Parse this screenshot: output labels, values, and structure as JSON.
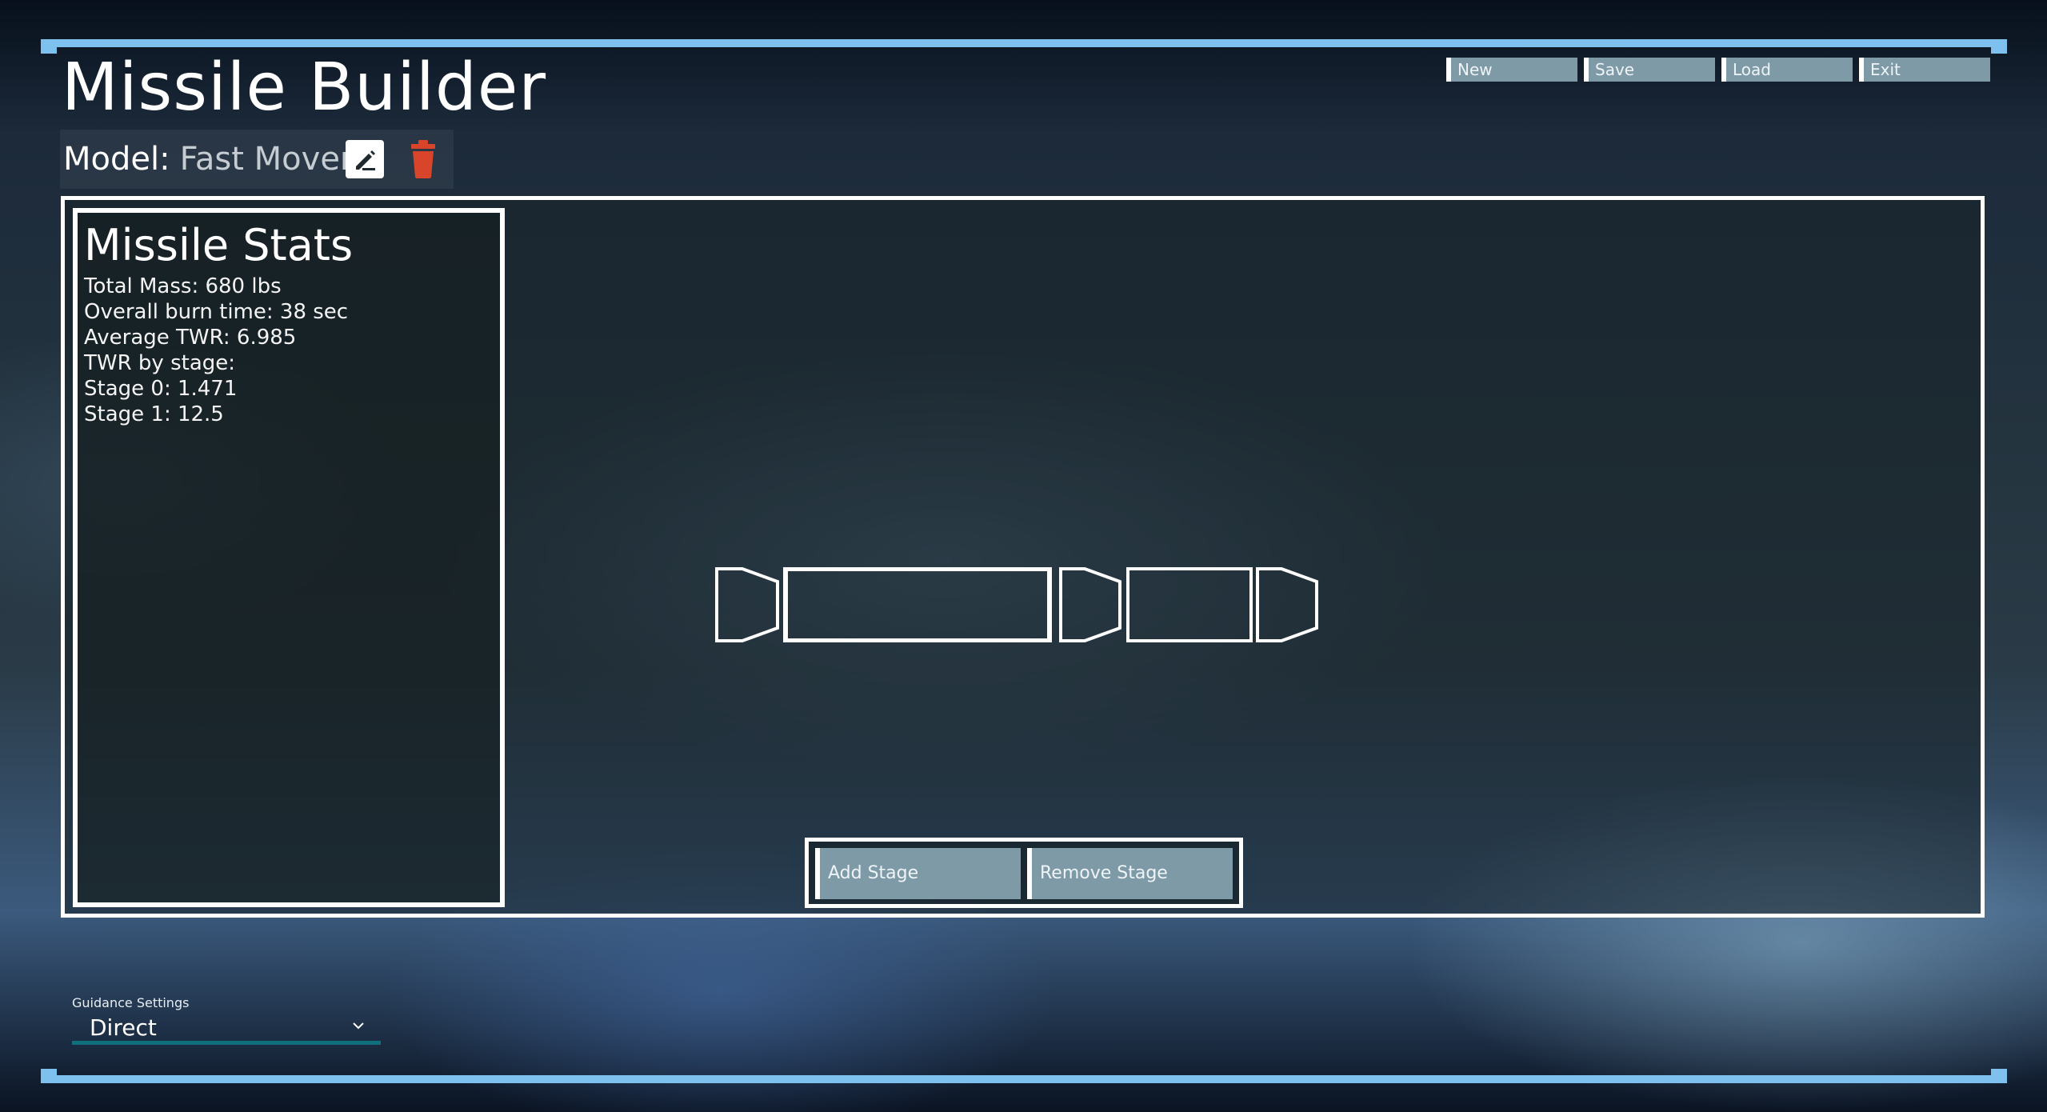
{
  "app": {
    "title": "Missile Builder"
  },
  "menu": {
    "items": [
      "New",
      "Save",
      "Load",
      "Exit"
    ]
  },
  "model": {
    "label": "Model:",
    "name": "Fast Mover",
    "edit_icon": "edit-icon",
    "delete_icon": "trash-icon"
  },
  "stats": {
    "title": "Missile Stats",
    "lines": [
      "Total Mass: 680 lbs",
      "Overall burn time: 38 sec",
      "Average TWR: 6.985",
      "TWR by stage:",
      "Stage 0: 1.471",
      "Stage 1: 12.5"
    ]
  },
  "stage_controls": {
    "add_label": "Add Stage",
    "remove_label": "Remove Stage"
  },
  "guidance": {
    "label": "Guidance Settings",
    "selected": "Direct"
  },
  "colors": {
    "accent_bar": "#7ec0ee",
    "button_fill": "#7e9aa7",
    "delete_red": "#d9452b",
    "select_underline": "#0f6f7d"
  }
}
